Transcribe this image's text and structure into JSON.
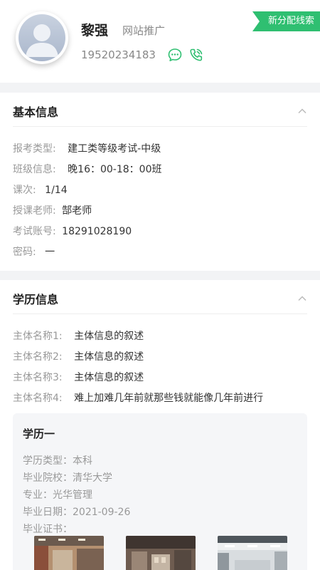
{
  "profile": {
    "name": "黎强",
    "source": "网站推广",
    "phone": "19520234183",
    "badge": "新分配线索",
    "accent": "#2fbf71"
  },
  "basic": {
    "title": "基本信息",
    "rows": [
      {
        "label": "报考类型:",
        "value": "建工类等级考试-中级"
      },
      {
        "label": "班级信息:",
        "value": "晚16：00-18：00班"
      },
      {
        "label": "课次:",
        "value": "1/14"
      },
      {
        "label": "授课老师:",
        "value": "郜老师"
      },
      {
        "label": "考试账号:",
        "value": "18291028190"
      },
      {
        "label": "密码:",
        "value": "一"
      }
    ]
  },
  "education": {
    "title": "学历信息",
    "rows": [
      {
        "label": "主体名称1:",
        "value": "主体信息的叙述"
      },
      {
        "label": "主体名称2:",
        "value": "主体信息的叙述"
      },
      {
        "label": "主体名称3:",
        "value": "主体信息的叙述"
      },
      {
        "label": "主体名称4:",
        "value": "难上加难几年前就那些钱就能像几年前进行"
      }
    ],
    "record": {
      "title": "学历一",
      "type": "学历类型：本科",
      "school": "毕业院校：清华大学",
      "major": "专业：光华管理",
      "date": "毕业日期：2021-09-26",
      "certificate": "毕业证书："
    }
  },
  "icons": {
    "chat": "chat-bubble-icon",
    "call": "phone-call-icon",
    "collapse": "chevron-up-icon",
    "avatar": "user-avatar-icon"
  }
}
